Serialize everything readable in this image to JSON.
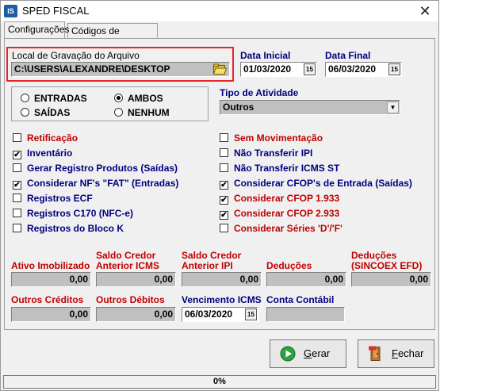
{
  "window": {
    "title": "SPED FISCAL",
    "icon_text": "IS",
    "close_glyph": "✕"
  },
  "tabs": [
    {
      "label": "Configurações"
    },
    {
      "label": "Códigos de Apuração"
    }
  ],
  "file_location": {
    "label": "Local de Gravação do Arquivo",
    "value": "C:\\USERS\\ALEXANDRE\\DESKTOP",
    "folder_icon": "folder-open-icon"
  },
  "dates": {
    "start_label": "Data Inicial",
    "start_value": "01/03/2020",
    "end_label": "Data Final",
    "end_value": "06/03/2020",
    "calendar_glyph": "15"
  },
  "movement_type": {
    "options": [
      {
        "label": "ENTRADAS",
        "selected": false
      },
      {
        "label": "AMBOS",
        "selected": true
      },
      {
        "label": "SAÍDAS",
        "selected": false
      },
      {
        "label": "NENHUM",
        "selected": false
      }
    ]
  },
  "activity": {
    "label": "Tipo de Atividade",
    "value": "Outros"
  },
  "checks_left": [
    {
      "label": "Retificação",
      "checked": false,
      "color": "red"
    },
    {
      "label": "Inventário",
      "checked": true,
      "color": "blue"
    },
    {
      "label": "Gerar Registro Produtos (Saídas)",
      "checked": false,
      "color": "blue"
    },
    {
      "label": "Considerar NF's \"FAT\" (Entradas)",
      "checked": true,
      "color": "blue"
    },
    {
      "label": "Registros ECF",
      "checked": false,
      "color": "blue"
    },
    {
      "label": "Registros C170 (NFC-e)",
      "checked": false,
      "color": "blue"
    },
    {
      "label": "Registros do Bloco K",
      "checked": false,
      "color": "blue"
    }
  ],
  "checks_right": [
    {
      "label": "Sem Movimentação",
      "checked": false,
      "color": "red"
    },
    {
      "label": "Não Transferir IPI",
      "checked": false,
      "color": "blue"
    },
    {
      "label": "Não Transferir ICMS ST",
      "checked": false,
      "color": "blue"
    },
    {
      "label": "Considerar CFOP's de Entrada (Saídas)",
      "checked": true,
      "color": "blue"
    },
    {
      "label": "Considerar CFOP 1.933",
      "checked": true,
      "color": "red"
    },
    {
      "label": "Considerar CFOP 2.933",
      "checked": true,
      "color": "red"
    },
    {
      "label": "Considerar Séries 'D'/'F'",
      "checked": false,
      "color": "red"
    }
  ],
  "values_row1": [
    {
      "label_l1": "",
      "label_l2": "Ativo Imobilizado",
      "value": "0,00",
      "color": "red"
    },
    {
      "label_l1": "Saldo Credor",
      "label_l2": "Anterior ICMS",
      "value": "0,00",
      "color": "red"
    },
    {
      "label_l1": "Saldo Credor",
      "label_l2": "Anterior IPI",
      "value": "0,00",
      "color": "red"
    },
    {
      "label_l1": "",
      "label_l2": "Deduções",
      "value": "0,00",
      "color": "red"
    },
    {
      "label_l1": "Deduções",
      "label_l2": "(SINCOEX EFD)",
      "value": "0,00",
      "color": "red"
    }
  ],
  "values_row2": {
    "other_credits_label": "Outros Créditos",
    "other_credits_value": "0,00",
    "other_debits_label": "Outros Débitos",
    "other_debits_value": "0,00",
    "due_label": "Vencimento ICMS",
    "due_value": "06/03/2020",
    "account_label": "Conta Contábil",
    "account_value": ""
  },
  "buttons": {
    "generate": "Gerar",
    "generate_underline": "G",
    "close": "Fechar",
    "close_underline": "F"
  },
  "status": {
    "progress_text": "0%",
    "progress": 0
  },
  "colors": {
    "red": "#c00000",
    "blue": "#00007f",
    "highlight": "#e8262a",
    "field_bg": "#c0c0c0"
  }
}
